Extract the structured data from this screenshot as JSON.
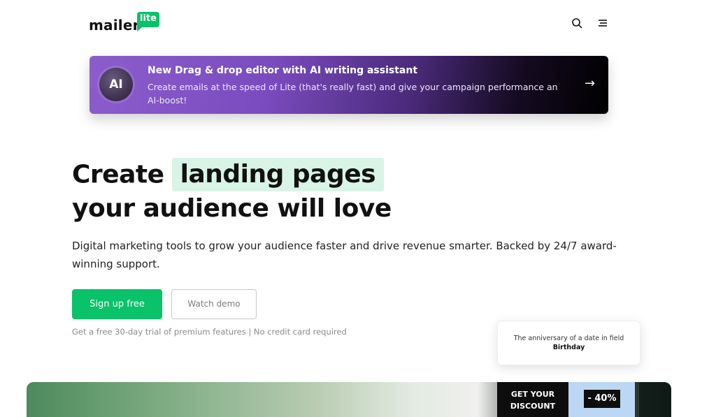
{
  "header": {
    "logo_text": "mailer",
    "logo_badge": "lite",
    "search_icon": "search-icon",
    "menu_icon": "menu-icon"
  },
  "banner": {
    "badge": "AI",
    "title": "New Drag & drop editor with AI writing assistant",
    "text": "Create emails at the speed of Lite (that's really fast) and give your campaign performance an AI-boost!",
    "arrow": "→",
    "gradient_start": "#8b5dcc",
    "gradient_end": "#000000"
  },
  "hero": {
    "line1_prefix": "Create",
    "line1_highlight": "landing pages",
    "line2": "your audience will love",
    "highlight_color": "#d8f4e6",
    "subtitle": "Digital marketing tools to grow your audience faster and drive revenue smarter. Backed by 24/7 award-winning support."
  },
  "actions": {
    "primary_label": "Sign up free",
    "secondary_label": "Watch demo",
    "trial_note": "Get a free 30-day trial of premium features | No credit card required",
    "primary_color": "#09c269"
  },
  "floating_card": {
    "text": "The anniversary of a date in field",
    "field": "Birthday"
  },
  "showcase": {
    "promo_line1": "GET YOUR",
    "promo_line2": "DISCOUNT",
    "discount": "- 40%"
  }
}
